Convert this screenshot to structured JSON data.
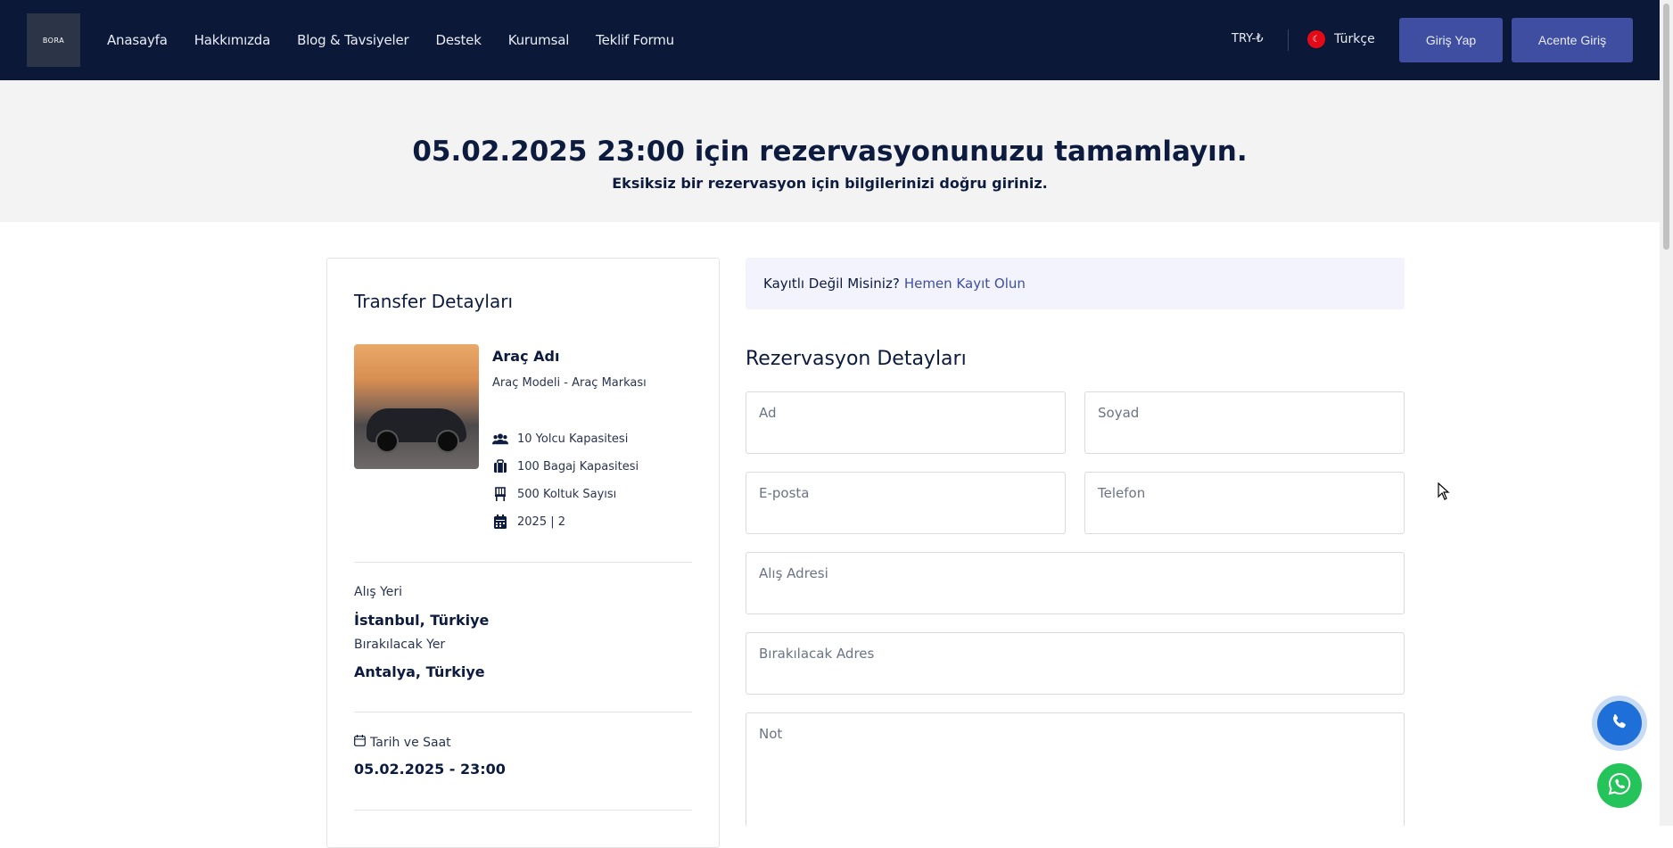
{
  "header": {
    "logo_text": "BORA",
    "nav": [
      "Anasayfa",
      "Hakkımızda",
      "Blog & Tavsiyeler",
      "Destek",
      "Kurumsal",
      "Teklif Formu"
    ],
    "currency": "TRY-₺",
    "language": "Türkçe",
    "login_label": "Giriş Yap",
    "agent_label": "Acente Giriş"
  },
  "hero": {
    "title": "05.02.2025 23:00 için rezervasyonunuzu tamamlayın.",
    "subtitle": "Eksiksiz bir rezervasyon için bilgilerinizi doğru giriniz."
  },
  "transfer": {
    "title": "Transfer Detayları",
    "car_name": "Araç Adı",
    "car_model": "Araç Modeli - Araç Markası",
    "specs": {
      "passengers": "10 Yolcu Kapasitesi",
      "luggage": "100 Bagaj Kapasitesi",
      "seats": "500 Koltuk Sayısı",
      "year": "2025 | 2"
    },
    "pickup_label": "Alış Yeri",
    "pickup_value": "İstanbul, Türkiye",
    "dropoff_label": "Bırakılacak Yer",
    "dropoff_value": "Antalya, Türkiye",
    "datetime_label": "Tarih ve Saat",
    "datetime_value": "05.02.2025 - 23:00"
  },
  "notice": {
    "text": "Kayıtlı Değil Misiniz?",
    "link": "Hemen Kayıt Olun"
  },
  "form": {
    "title": "Rezervasyon Detayları",
    "first_name": "Ad",
    "last_name": "Soyad",
    "email": "E-posta",
    "phone": "Telefon",
    "pickup_address": "Alış Adresi",
    "dropoff_address": "Bırakılacak Adres",
    "note": "Not"
  },
  "colors": {
    "header_bg": "#0b1838",
    "accent": "#3f4ea0",
    "hero_bg": "#f3f3f3",
    "notice_bg": "#f2f3fd",
    "phone_fab": "#1f6fd8",
    "whatsapp_fab": "#25c45a"
  },
  "icons": {
    "passengers": "users-icon",
    "luggage": "suitcase-icon",
    "seats": "chair-icon",
    "year": "calendar-icon",
    "date": "calendar-outline-icon",
    "phone": "phone-icon",
    "whatsapp": "whatsapp-icon"
  }
}
